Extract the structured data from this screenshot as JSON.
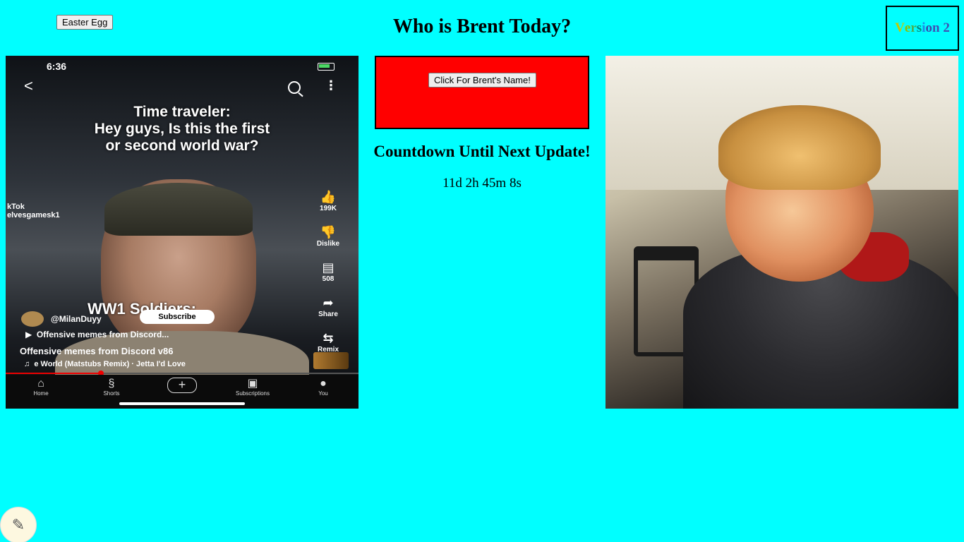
{
  "page": {
    "title": "Who is Brent Today?",
    "easter_egg_label": "Easter Egg",
    "version_letters": [
      {
        "ch": "V",
        "color": "#c8c800"
      },
      {
        "ch": "e",
        "color": "#8fbf00"
      },
      {
        "ch": "r",
        "color": "#4caf50"
      },
      {
        "ch": "s",
        "color": "#00897b"
      },
      {
        "ch": "i",
        "color": "#1e88e5"
      },
      {
        "ch": "o",
        "color": "#3949ab"
      },
      {
        "ch": "n",
        "color": "#3f51b5"
      },
      {
        "ch": " ",
        "color": "#3f51b5"
      },
      {
        "ch": "2",
        "color": "#3f51b5"
      }
    ],
    "name_button_label": "Click For Brent's Name!",
    "countdown_title": "Countdown Until Next Update!",
    "countdown_value": "11d 2h 45m 8s"
  },
  "phone": {
    "time": "6:36",
    "caption_line1": "Time traveler:",
    "caption_line2": "Hey guys, Is this the first",
    "caption_line3": "or second world war?",
    "tiktok_brand": "kTok",
    "tiktok_handle": "elvesgamesk1",
    "likes": "199K",
    "dislike": "Dislike",
    "comments": "508",
    "share": "Share",
    "remix": "Remix",
    "overlay_title": "WW1 Soldiers:",
    "channel": "@MilanDuyy",
    "subscribe": "Subscribe",
    "play_row": "Offensive memes from Discord...",
    "description": "Offensive memes from Discord v86",
    "music": "e World (Matstubs Remix) · Jetta    I'd Love",
    "progress": 0.27,
    "nav": [
      "Home",
      "Shorts",
      "",
      "Subscriptions",
      "You"
    ]
  },
  "colors": {
    "background": "#00ffff",
    "red_box": "#ff0000"
  }
}
